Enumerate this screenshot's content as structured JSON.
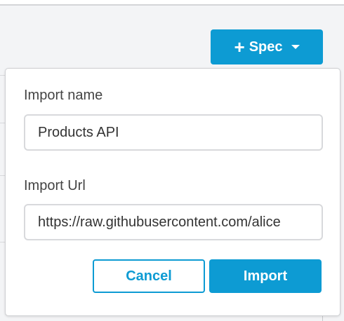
{
  "toolbar": {
    "spec_button_label": "Spec",
    "spec_button_icon": "plus-icon",
    "accent_color": "#0d9bd3"
  },
  "import_dialog": {
    "name_label": "Import name",
    "name_value": "Products API",
    "url_label": "Import Url",
    "url_value": "https://raw.githubusercontent.com/alice",
    "cancel_label": "Cancel",
    "import_label": "Import"
  }
}
